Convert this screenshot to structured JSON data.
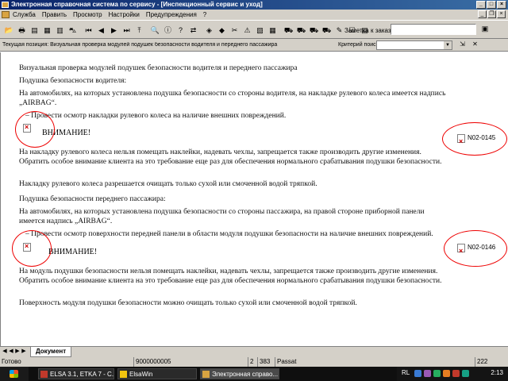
{
  "window": {
    "title": "Электронная справочная система по сервису - [Инспекционный сервис и уход]",
    "controls": [
      "_",
      "□",
      "×"
    ]
  },
  "menu": {
    "items": [
      "Служба",
      "Править",
      "Просмотр",
      "Настройки",
      "Предупреждения",
      "?"
    ],
    "mdi_controls": [
      "_",
      "❐",
      "×"
    ]
  },
  "toolbar": {
    "buttons": [
      {
        "name": "folder-icon",
        "glyph": "📂"
      },
      {
        "name": "print-icon",
        "glyph": "🖶"
      },
      {
        "name": "document-icon",
        "glyph": "▤"
      },
      {
        "name": "document-list-icon",
        "glyph": "▦"
      },
      {
        "name": "book-icon",
        "glyph": "▥"
      },
      {
        "name": "car-icon",
        "glyph": "⛍"
      },
      {
        "name": "nav-first-icon",
        "glyph": "⏮"
      },
      {
        "name": "nav-prev-icon",
        "glyph": "◀"
      },
      {
        "name": "nav-next-icon",
        "glyph": "▶"
      },
      {
        "name": "nav-last-icon",
        "glyph": "⏭"
      },
      {
        "name": "up-arrow-icon",
        "glyph": "⤒"
      },
      {
        "name": "search-icon",
        "glyph": "🔍"
      },
      {
        "name": "info-icon",
        "glyph": "ⓘ"
      },
      {
        "name": "help-icon",
        "glyph": "?"
      },
      {
        "name": "transfer-icon",
        "glyph": "⇄"
      },
      {
        "name": "cube-icon",
        "glyph": "◈"
      },
      {
        "name": "bookmark-icon",
        "glyph": "◆"
      },
      {
        "name": "tools-icon",
        "glyph": "✂"
      },
      {
        "name": "warning-icon",
        "glyph": "⚠"
      },
      {
        "name": "image-icon",
        "glyph": "▧"
      },
      {
        "name": "table-icon",
        "glyph": "▦"
      },
      {
        "name": "car-service-icon",
        "glyph": "⛟"
      },
      {
        "name": "car-repair-icon",
        "glyph": "⛟"
      },
      {
        "name": "car-wiring-icon",
        "glyph": "⛟"
      },
      {
        "name": "car-body-icon",
        "glyph": "⛟"
      },
      {
        "name": "edit-icon",
        "glyph": "✎"
      },
      {
        "name": "checklist-icon",
        "glyph": "☑"
      },
      {
        "name": "notes-icon",
        "glyph": "▤"
      }
    ],
    "note_label": "Заметка к заказу:",
    "note_value": ""
  },
  "pathrow": {
    "path": "Текущая позиция: Визуальная проверка модулей подушек безопасности водителя и переднего пассажира",
    "criteria_label": "Критерий поиска:",
    "criteria_value": ""
  },
  "document": {
    "heading": "Визуальная проверка модулей подушек безопасности водителя и переднего пассажира",
    "driver_title": "Подушка безопасности водителя:",
    "driver_text": "На автомобилях, на которых установлена подушка безопасности со стороны водителя, на накладке рулевого колеса имеется надпись „AIRBAG“.",
    "driver_step": "– Провести осмотр накладки рулевого колеса на наличие внешних повреждений.",
    "warning1_title": "ВНИМАНИЕ!",
    "warning1_text": "На накладку рулевого колеса нельзя помещать наклейки, надевать чехлы, запрещается также производить другие изменения. Обратить особое внимание клиента на это требование еще раз для обеспечения нормального срабатывания подушки безопасности.",
    "driver_cleaning": "Накладку рулевого колеса разрешается очищать только сухой или смоченной водой тряпкой.",
    "passenger_title": "Подушка безопасности переднего пассажира:",
    "passenger_text": "На автомобилях, на которых установлена подушка безопасности со стороны пассажира, на правой стороне приборной панели имеется надпись „AIRBAG“.",
    "passenger_step": "– Провести осмотр поверхности передней панели в области модуля подушки безопасности на наличие внешних повреждений.",
    "warning2_title": "ВНИМАНИЕ!",
    "warning2_text": "На модуль подушки безопасности нельзя помещать наклейки, надевать чехлы, запрещается также производить другие изменения. Обратить особое внимание клиента на это требование еще раз для обеспечения нормального срабатывания подушки безопасности.",
    "passenger_cleaning": "Поверхность модуля подушки безопасности можно очищать только сухой или смоченной водой тряпкой.",
    "ref1": "N02-0145",
    "ref2": "N02-0146"
  },
  "tabs": {
    "nav": [
      "◀",
      "◀",
      "▶",
      "▶"
    ],
    "active_tab": "Документ"
  },
  "status": {
    "ready": "Готово",
    "order": "9000000005",
    "f1": "2",
    "f2": "383",
    "model": "Passat",
    "page": "222"
  },
  "taskbar": {
    "tasks": [
      {
        "label": "ELSA 3.1, ETKA 7 - C...",
        "icon_color": "#c0392b"
      },
      {
        "label": "ElsaWin",
        "icon_color": "#f1c40f"
      },
      {
        "label": "Электронная справо...",
        "icon_color": "#d9a441"
      }
    ],
    "lang": "RL",
    "clock": "2:13"
  },
  "colors": {
    "annotation": "#e00000",
    "title_bar": "#0a246a"
  }
}
